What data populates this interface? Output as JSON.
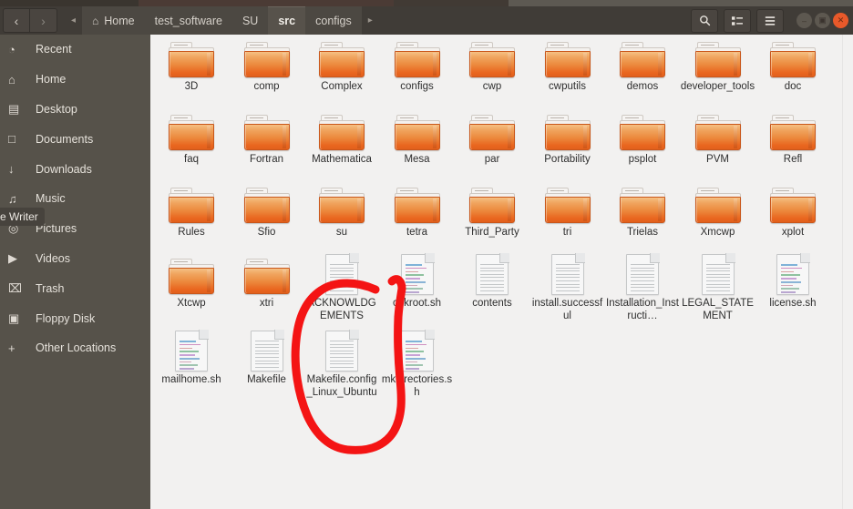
{
  "window": {
    "titlebar_visible_sliver": true,
    "controls": {
      "minimize": "–",
      "maximize": "▣",
      "close": "✕"
    }
  },
  "toolbar": {
    "back_label": "‹",
    "forward_label": "›",
    "prev_crumb_arrow": "◂",
    "next_crumb_arrow": "▸",
    "home_icon": "⌂",
    "search_icon": "🔍",
    "view_toggle_icon": "list-view",
    "menu_icon": "☰",
    "breadcrumbs": [
      {
        "label": "Home",
        "active": false,
        "home": true
      },
      {
        "label": "test_software",
        "active": false,
        "home": false
      },
      {
        "label": "SU",
        "active": false,
        "home": false
      },
      {
        "label": "src",
        "active": true,
        "home": false
      },
      {
        "label": "configs",
        "active": false,
        "home": false
      }
    ]
  },
  "sidebar": {
    "items": [
      {
        "label": "Recent",
        "icon": "◔"
      },
      {
        "label": "Home",
        "icon": "⌂"
      },
      {
        "label": "Desktop",
        "icon": "▤"
      },
      {
        "label": "Documents",
        "icon": "□"
      },
      {
        "label": "Downloads",
        "icon": "↓"
      },
      {
        "label": "Music",
        "icon": "♫"
      },
      {
        "label": "Pictures",
        "icon": "◎"
      },
      {
        "label": "Videos",
        "icon": "▶"
      },
      {
        "label": "Trash",
        "icon": "⌧"
      },
      {
        "label": "Floppy Disk",
        "icon": "▣"
      },
      {
        "label": "Other Locations",
        "icon": "+"
      }
    ],
    "tooltip": "e Writer"
  },
  "files": [
    {
      "name": "3D",
      "type": "folder"
    },
    {
      "name": "comp",
      "type": "folder"
    },
    {
      "name": "Complex",
      "type": "folder"
    },
    {
      "name": "configs",
      "type": "folder"
    },
    {
      "name": "cwp",
      "type": "folder"
    },
    {
      "name": "cwputils",
      "type": "folder"
    },
    {
      "name": "demos",
      "type": "folder"
    },
    {
      "name": "developer_tools",
      "type": "folder"
    },
    {
      "name": "doc",
      "type": "folder"
    },
    {
      "name": "faq",
      "type": "folder"
    },
    {
      "name": "Fortran",
      "type": "folder"
    },
    {
      "name": "Mathematica",
      "type": "folder"
    },
    {
      "name": "Mesa",
      "type": "folder"
    },
    {
      "name": "par",
      "type": "folder"
    },
    {
      "name": "Portability",
      "type": "folder"
    },
    {
      "name": "psplot",
      "type": "folder"
    },
    {
      "name": "PVM",
      "type": "folder"
    },
    {
      "name": "Refl",
      "type": "folder"
    },
    {
      "name": "Rules",
      "type": "folder"
    },
    {
      "name": "Sfio",
      "type": "folder"
    },
    {
      "name": "su",
      "type": "folder"
    },
    {
      "name": "tetra",
      "type": "folder"
    },
    {
      "name": "Third_Party",
      "type": "folder"
    },
    {
      "name": "tri",
      "type": "folder"
    },
    {
      "name": "Trielas",
      "type": "folder"
    },
    {
      "name": "Xmcwp",
      "type": "folder"
    },
    {
      "name": "xplot",
      "type": "folder"
    },
    {
      "name": "Xtcwp",
      "type": "folder"
    },
    {
      "name": "xtri",
      "type": "folder"
    },
    {
      "name": "ACKNOWLDGEMENTS",
      "type": "text"
    },
    {
      "name": "chkroot.sh",
      "type": "script"
    },
    {
      "name": "contents",
      "type": "text"
    },
    {
      "name": "install.successful",
      "type": "text"
    },
    {
      "name": "Installation_Instructi…",
      "type": "text"
    },
    {
      "name": "LEGAL_STATEMENT",
      "type": "text"
    },
    {
      "name": "license.sh",
      "type": "script"
    },
    {
      "name": "mailhome.sh",
      "type": "script"
    },
    {
      "name": "Makefile",
      "type": "text"
    },
    {
      "name": "Makefile.config_Linux_Ubuntu",
      "type": "text"
    },
    {
      "name": "mkdirectories.sh",
      "type": "script"
    }
  ],
  "annotation": {
    "shape": "hand-drawn-red-circle",
    "color": "#f41414",
    "targets": [
      "Makefile.config_Linux_Ubuntu"
    ]
  },
  "colors": {
    "chrome": "#403c37",
    "sidebar": "#56524a",
    "content": "#f2f1f0",
    "folder_orange": "#ec8a3e",
    "close_button": "#e8592a",
    "annotation_red": "#f41414"
  }
}
